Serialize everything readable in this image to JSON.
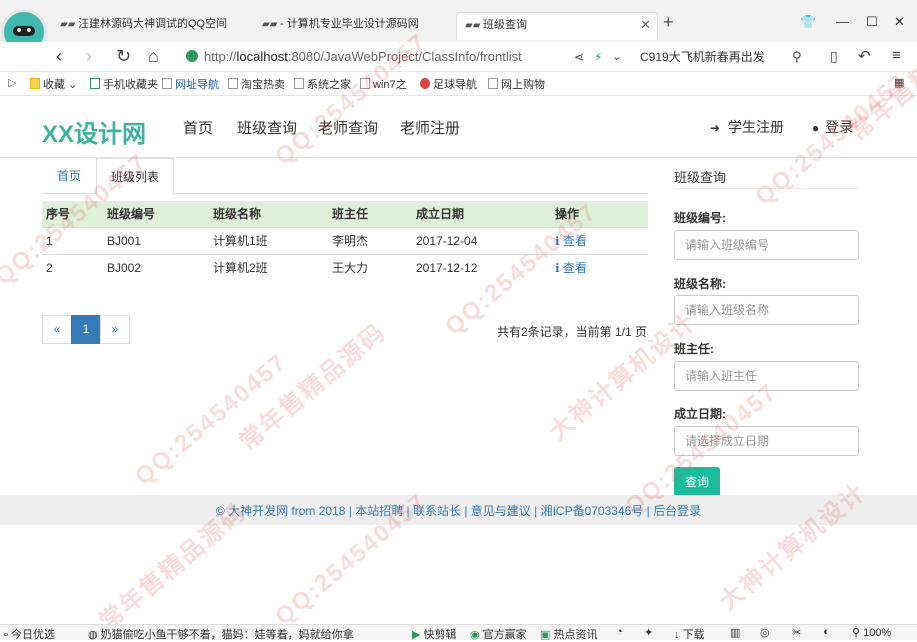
{
  "browser": {
    "tabs": [
      {
        "label": "汪建林源码大神调试的QQ空间",
        "active": false
      },
      {
        "label": "- 计算机专业毕业设计源码网",
        "active": false
      },
      {
        "label": "班级查询",
        "active": true
      }
    ],
    "url_prefix": "http://",
    "url_host": "localhost",
    "url_rest": ":8080/JavaWebProject/ClassInfo/frontlist",
    "search_text": "C919大飞机新春再出发",
    "bookmarks": [
      "收藏",
      "手机收藏夹",
      "网址导航",
      "淘宝热卖",
      "系统之家",
      "win7之",
      "足球导航",
      "网上购物"
    ]
  },
  "site": {
    "brand": "XX设计网",
    "nav": [
      "首页",
      "班级查询",
      "老师查询",
      "老师注册"
    ],
    "register": "学生注册",
    "login": "登录"
  },
  "main": {
    "tabs": [
      "首页",
      "班级列表"
    ],
    "columns": [
      "序号",
      "班级编号",
      "班级名称",
      "班主任",
      "成立日期",
      "操作"
    ],
    "rows": [
      [
        "1",
        "BJ001",
        "计算机1班",
        "李明杰",
        "2017-12-04",
        "查看"
      ],
      [
        "2",
        "BJ002",
        "计算机2班",
        "王大力",
        "2017-12-12",
        "查看"
      ]
    ],
    "pager": [
      "«",
      "1",
      "»"
    ],
    "record_info": "共有2条记录，当前第 1/1 页"
  },
  "sidebar": {
    "title": "班级查询",
    "fields": [
      {
        "label": "班级编号:",
        "placeholder": "请输入班级编号"
      },
      {
        "label": "班级名称:",
        "placeholder": "请输入班级名称"
      },
      {
        "label": "班主任:",
        "placeholder": "请输入班主任"
      },
      {
        "label": "成立日期:",
        "placeholder": "请选择成立日期"
      }
    ],
    "query_button": "查询"
  },
  "footer": {
    "text": "© 大神开发网 from 2018 | 本站招聘 | 联系站长 | 意见与建议 | 湘ICP备0703346号 | 后台登录"
  },
  "statusbar": {
    "left": "今日优选",
    "news": "奶猫偷吃小鱼干够不着，猫妈：娃等着，妈就给你拿",
    "items": [
      "快剪辑",
      "官方赢家",
      "热点资讯",
      "下载",
      "100%"
    ]
  },
  "watermarks": [
    "QQ:254540457",
    "常年售精品源码",
    "大神计算机设计"
  ],
  "colors": {
    "brand": "#3db39e",
    "table_header": "#dff0d8",
    "link": "#337ab7",
    "button": "#1abc9c"
  }
}
